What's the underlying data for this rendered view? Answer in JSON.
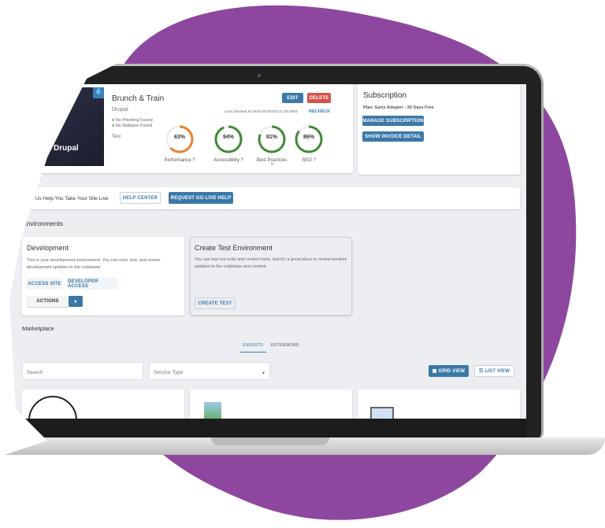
{
  "site": {
    "title": "Brunch & Train",
    "cms": "Drupal",
    "image_label": "Drupal",
    "checks": [
      "No Phishing Found",
      "No Malware Found"
    ],
    "tag": "Test",
    "last_checked": "Last checked at 2024-04-03T15:11:26.000Z",
    "recheck": "RECHECK",
    "edit": "EDIT",
    "delete": "DELETE",
    "scores": [
      {
        "label": "Performance",
        "value": 63,
        "text": "63%",
        "color": "#e8812f"
      },
      {
        "label": "Accessibility",
        "value": 94,
        "text": "94%",
        "color": "#3f8a34"
      },
      {
        "label": "Best Practices",
        "value": 81,
        "text": "81%",
        "color": "#3f8a34"
      },
      {
        "label": "SEO",
        "value": 86,
        "text": "86%",
        "color": "#3f8a34"
      }
    ]
  },
  "subscription": {
    "title": "Subscription",
    "plan": "Plan: Early Adopter - 30 Days Free",
    "manage": "MANAGE SUBSCRIPTION",
    "invoice": "SHOW INVOICE DETAIL"
  },
  "golive": {
    "text": "Let Us Help You Take Your Site Live",
    "help": "HELP CENTER",
    "request": "REQUEST GO LIVE HELP"
  },
  "environments": {
    "title": "Environments",
    "dev": {
      "title": "Development",
      "desc": "This is your development environment. You can view, test, and review development updates to the codebase",
      "access": "ACCESS SITE",
      "developer": "DEVELOPER ACCESS",
      "actions": "ACTIONS"
    },
    "test": {
      "title": "Create Test Environment",
      "desc": "You can test out code and content here, and it's a great place to review iterative updates to the codebase and content.",
      "create": "CREATE TEST"
    }
  },
  "marketplace": {
    "title": "Marketplace",
    "tabs": [
      "EXPERTS",
      "EXTENSIONS"
    ],
    "active_tab": "EXPERTS",
    "search_placeholder": "Search",
    "service_type": "Service Type",
    "grid": "GRID VIEW",
    "list": "LIST VIEW"
  },
  "colors": {
    "accent": "#3b78a8",
    "purple": "#8e479e",
    "danger": "#d1534a"
  }
}
